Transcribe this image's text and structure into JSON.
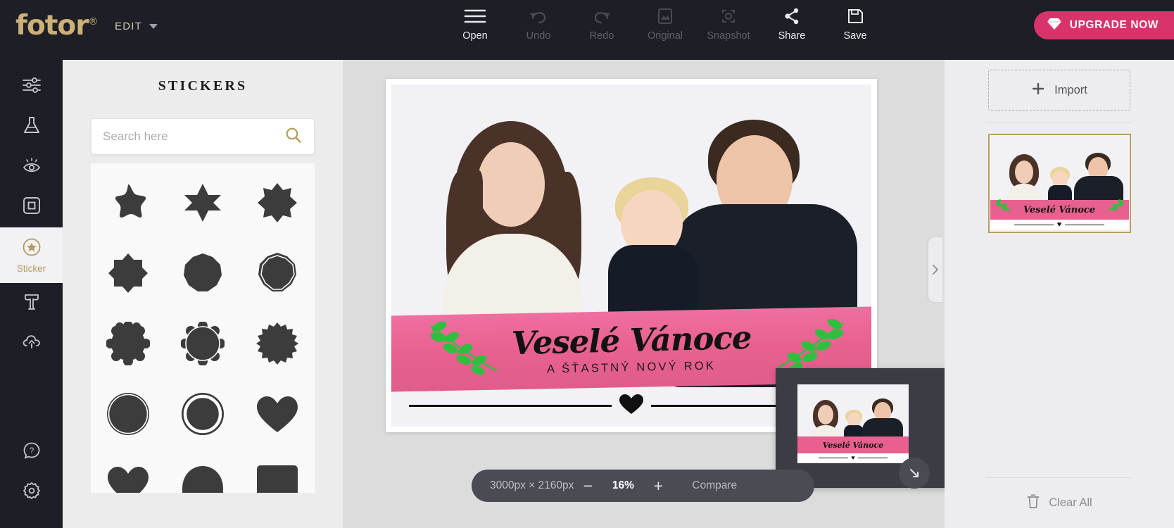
{
  "brand": {
    "name": "fotor",
    "mark": "®"
  },
  "header": {
    "edit_menu": "EDIT",
    "tools": [
      {
        "label": "Open",
        "icon": "hamburger-icon",
        "disabled": false
      },
      {
        "label": "Undo",
        "icon": "undo-icon",
        "disabled": true
      },
      {
        "label": "Redo",
        "icon": "redo-icon",
        "disabled": true
      },
      {
        "label": "Original",
        "icon": "original-image-icon",
        "disabled": true
      },
      {
        "label": "Snapshot",
        "icon": "snapshot-icon",
        "disabled": true
      },
      {
        "label": "Share",
        "icon": "share-icon",
        "disabled": false
      },
      {
        "label": "Save",
        "icon": "save-disk-icon",
        "disabled": false
      }
    ],
    "upgrade_label": "UPGRADE NOW",
    "upgrade_icon": "diamond-icon",
    "upgrade_color": "#d9336b"
  },
  "sidebar": {
    "items": [
      {
        "label": "",
        "icon": "sliders-adjust-icon",
        "active": false
      },
      {
        "label": "",
        "icon": "flask-effects-icon",
        "active": false
      },
      {
        "label": "",
        "icon": "eye-beauty-icon",
        "active": false
      },
      {
        "label": "",
        "icon": "frame-icon",
        "active": false
      },
      {
        "label": "Sticker",
        "icon": "star-badge-icon",
        "active": true
      },
      {
        "label": "",
        "icon": "text-t-icon",
        "active": false
      },
      {
        "label": "",
        "icon": "cloud-upload-icon",
        "active": false
      }
    ],
    "bottom_items": [
      {
        "label": "",
        "icon": "help-question-icon"
      },
      {
        "label": "",
        "icon": "settings-gear-icon"
      }
    ],
    "active_color": "#b09a60"
  },
  "panel": {
    "title": "STICKERS",
    "search": {
      "placeholder": "Search here",
      "value": "",
      "icon": "search-icon"
    },
    "shapes": [
      "rounded-star-5",
      "star-6",
      "star-8",
      "octagon-star",
      "nonagon",
      "scalloped-nonagon-outline",
      "cloud-circle",
      "scalloped-circle-outline",
      "burst-circle",
      "circle-thin-ring",
      "circle-thick-ring",
      "heart",
      "heart",
      "dome",
      "rounded-square"
    ],
    "shape_color": "#3c3c3c"
  },
  "canvas": {
    "card_text": {
      "main": "Veselé Vánoce",
      "sub": "A ŠŤASTNÝ NOVÝ ROK"
    },
    "banner_color": "#e8608f",
    "leaf_color": "#2fbf3f",
    "handle_icon": "chevron-right-icon",
    "navigator": {
      "icon": "resize-arrow-icon"
    }
  },
  "zoombar": {
    "dimensions": "3000px × 2160px",
    "minus": "−",
    "zoom": "16%",
    "plus": "+",
    "compare": "Compare"
  },
  "right_panel": {
    "import_label": "Import",
    "import_icon": "plus-icon",
    "thumbnail_border": "#b59d63",
    "clear_all_label": "Clear All",
    "clear_all_icon": "trash-icon"
  }
}
